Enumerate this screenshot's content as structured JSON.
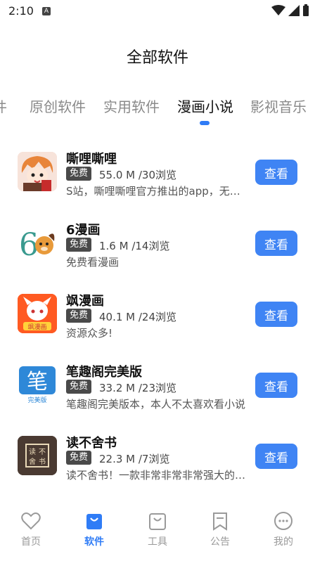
{
  "status": {
    "time": "2:10",
    "notif": "A"
  },
  "header": {
    "title": "全部软件"
  },
  "tabs": [
    {
      "label": "件"
    },
    {
      "label": "原创软件"
    },
    {
      "label": "实用软件"
    },
    {
      "label": "漫画小说",
      "active": true
    },
    {
      "label": "影视音乐"
    }
  ],
  "apps": [
    {
      "name": "嘶哩嘶哩",
      "badge": "免费",
      "meta": "55.0 M /30浏览",
      "desc": "S站，嘶哩嘶哩官方推出的app，无广告",
      "button": "查看"
    },
    {
      "name": "6漫画",
      "badge": "免费",
      "meta": "1.6 M /14浏览",
      "desc": "免费看漫画",
      "button": "查看"
    },
    {
      "name": "飒漫画",
      "badge": "免费",
      "meta": "40.1 M /24浏览",
      "desc": "资源众多!",
      "button": "查看"
    },
    {
      "name": "笔趣阁完美版",
      "badge": "免费",
      "meta": "33.2 M /23浏览",
      "desc": "笔趣阁完美版本，本人不太喜欢看小说",
      "button": "查看"
    },
    {
      "name": "读不舍书",
      "badge": "免费",
      "meta": "22.3 M /7浏览",
      "desc": "读不舍书！一款非常非常非常强大的阅读",
      "button": "查看"
    }
  ],
  "icons": {
    "app2": "6",
    "app3": "飒漫画",
    "app4": "笔",
    "app4sub": "完美版",
    "app5": [
      "读",
      "不",
      "舍",
      "书"
    ]
  },
  "nav": [
    {
      "label": "首页",
      "icon": "heart-icon"
    },
    {
      "label": "软件",
      "icon": "bag-icon",
      "active": true
    },
    {
      "label": "工具",
      "icon": "shopping-bag-icon"
    },
    {
      "label": "公告",
      "icon": "bookmark-icon"
    },
    {
      "label": "我的",
      "icon": "smile-icon"
    }
  ],
  "colors": {
    "accent": "#2f7cf6",
    "button": "#3f84f4",
    "badge": "#4a4a4a"
  }
}
